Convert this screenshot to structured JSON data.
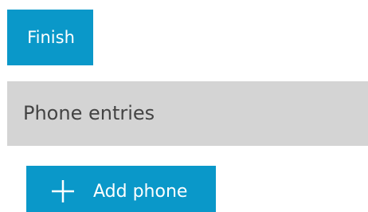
{
  "finish_button": {
    "label": "Finish"
  },
  "phone_section": {
    "title": "Phone entries"
  },
  "add_phone_button": {
    "label": "Add phone",
    "icon": "plus-icon"
  },
  "colors": {
    "accent": "#0a98c9",
    "header_bg": "#d4d4d4",
    "header_text": "#444444"
  }
}
